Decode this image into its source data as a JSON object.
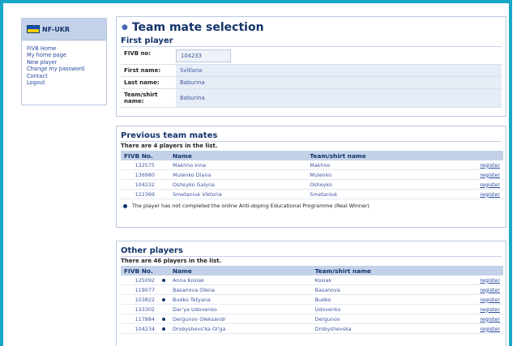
{
  "brand": {
    "name": "NF-UKR"
  },
  "menu": [
    "FIVB Home",
    "My home page",
    "New player",
    "Change my password",
    "Contact",
    "Logout"
  ],
  "page_title": "Team mate selection",
  "first_player": {
    "section_title": "First player",
    "fields": [
      {
        "label": "FIVB no:",
        "value": "104233"
      },
      {
        "label": "First name:",
        "value": "Svitlana"
      },
      {
        "label": "Last name:",
        "value": "Baburina"
      },
      {
        "label": "Team/shirt name:",
        "value": "Baburina"
      }
    ]
  },
  "previous": {
    "section_title": "Previous team mates",
    "count_text": "There are 4 players in the list.",
    "headers": {
      "no": "FIVB No.",
      "name": "Name",
      "team": "Team/shirt name"
    },
    "rows": [
      {
        "no": "132575",
        "name": "Makhno Inna",
        "team": "Makhno",
        "action": "register"
      },
      {
        "no": "136980",
        "name": "Mulenko Diana",
        "team": "Mulenko",
        "action": "register"
      },
      {
        "no": "104232",
        "name": "Osheyko Galyna",
        "team": "Osheyko",
        "action": "register"
      },
      {
        "no": "122369",
        "name": "Smetaniuk Viktoria",
        "team": "Smetaniuk",
        "action": "register"
      }
    ],
    "note": "The player has not completed the online Anti-doping Educational Programme (Real Winner)"
  },
  "other": {
    "section_title": "Other players",
    "count_text": "There are 46 players in the list.",
    "headers": {
      "no": "FIVB No.",
      "name": "Name",
      "team": "Team/shirt name"
    },
    "rows": [
      {
        "no": "125092",
        "bullet": true,
        "name": "Anna Kosiak",
        "team": "Kosiak",
        "action": "register"
      },
      {
        "no": "119077",
        "bullet": false,
        "name": "Basanova Olena",
        "team": "Basanova",
        "action": "register"
      },
      {
        "no": "103822",
        "bullet": true,
        "name": "Budko Tetyana",
        "team": "Budko",
        "action": "register"
      },
      {
        "no": "133302",
        "bullet": false,
        "name": "Dar'ya Udovenko",
        "team": "Udovenko",
        "action": "register"
      },
      {
        "no": "117884",
        "bullet": true,
        "name": "Dergunov Oleksandr",
        "team": "Dergunov",
        "action": "register"
      },
      {
        "no": "104234",
        "bullet": true,
        "name": "Drobyshevs'ka Ol'ga",
        "team": "Drobyshevska",
        "action": "register"
      }
    ]
  }
}
